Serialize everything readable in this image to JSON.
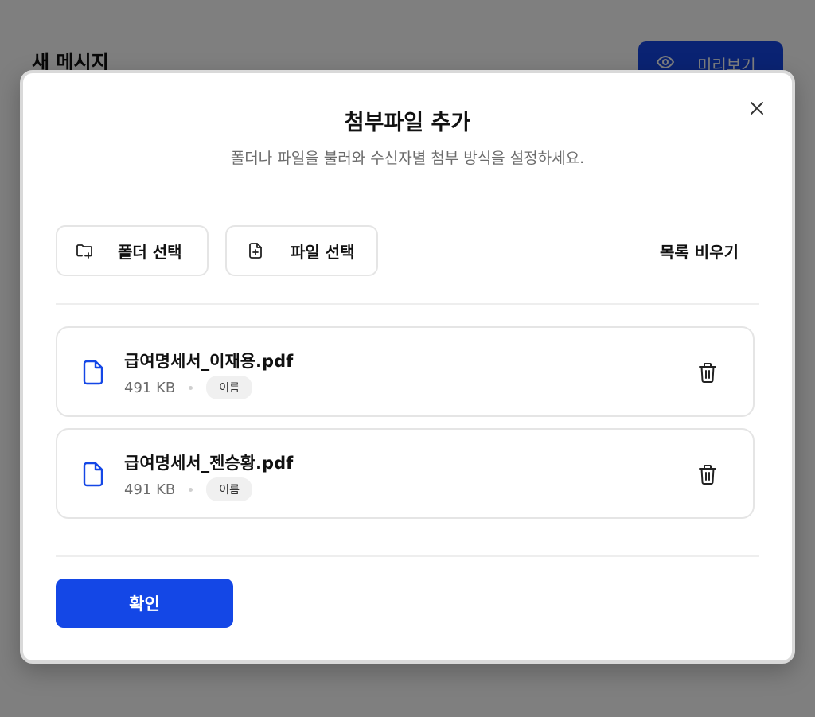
{
  "background": {
    "page_title": "새 메시지",
    "preview_label": "미리보기"
  },
  "modal": {
    "title": "첨부파일 추가",
    "subtitle": "폴더나 파일을 불러와 수신자별 첨부 방식을 설정하세요.",
    "toolbar": {
      "folder_label": "폴더 선택",
      "file_label": "파일 선택",
      "clear_label": "목록 비우기"
    },
    "files": [
      {
        "name": "급여명세서_이재용.pdf",
        "size": "491 KB",
        "badge": "이름"
      },
      {
        "name": "급여명세서_젠승황.pdf",
        "size": "491 KB",
        "badge": "이름"
      }
    ],
    "confirm_label": "확인"
  },
  "colors": {
    "accent": "#1447e6",
    "overlay": "rgba(0,0,0,0.5)"
  }
}
